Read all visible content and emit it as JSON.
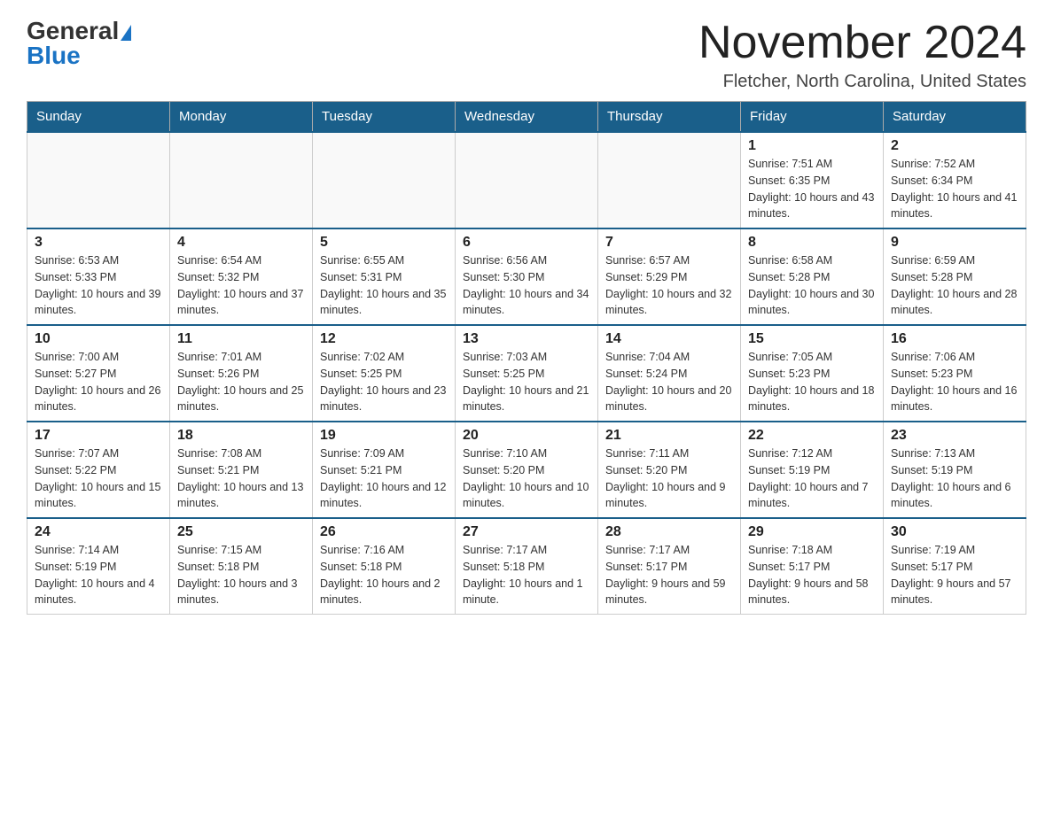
{
  "logo": {
    "general": "General",
    "triangle": "",
    "blue": "Blue"
  },
  "header": {
    "month": "November 2024",
    "location": "Fletcher, North Carolina, United States"
  },
  "days_of_week": [
    "Sunday",
    "Monday",
    "Tuesday",
    "Wednesday",
    "Thursday",
    "Friday",
    "Saturday"
  ],
  "weeks": [
    [
      {
        "day": "",
        "info": ""
      },
      {
        "day": "",
        "info": ""
      },
      {
        "day": "",
        "info": ""
      },
      {
        "day": "",
        "info": ""
      },
      {
        "day": "",
        "info": ""
      },
      {
        "day": "1",
        "info": "Sunrise: 7:51 AM\nSunset: 6:35 PM\nDaylight: 10 hours and 43 minutes."
      },
      {
        "day": "2",
        "info": "Sunrise: 7:52 AM\nSunset: 6:34 PM\nDaylight: 10 hours and 41 minutes."
      }
    ],
    [
      {
        "day": "3",
        "info": "Sunrise: 6:53 AM\nSunset: 5:33 PM\nDaylight: 10 hours and 39 minutes."
      },
      {
        "day": "4",
        "info": "Sunrise: 6:54 AM\nSunset: 5:32 PM\nDaylight: 10 hours and 37 minutes."
      },
      {
        "day": "5",
        "info": "Sunrise: 6:55 AM\nSunset: 5:31 PM\nDaylight: 10 hours and 35 minutes."
      },
      {
        "day": "6",
        "info": "Sunrise: 6:56 AM\nSunset: 5:30 PM\nDaylight: 10 hours and 34 minutes."
      },
      {
        "day": "7",
        "info": "Sunrise: 6:57 AM\nSunset: 5:29 PM\nDaylight: 10 hours and 32 minutes."
      },
      {
        "day": "8",
        "info": "Sunrise: 6:58 AM\nSunset: 5:28 PM\nDaylight: 10 hours and 30 minutes."
      },
      {
        "day": "9",
        "info": "Sunrise: 6:59 AM\nSunset: 5:28 PM\nDaylight: 10 hours and 28 minutes."
      }
    ],
    [
      {
        "day": "10",
        "info": "Sunrise: 7:00 AM\nSunset: 5:27 PM\nDaylight: 10 hours and 26 minutes."
      },
      {
        "day": "11",
        "info": "Sunrise: 7:01 AM\nSunset: 5:26 PM\nDaylight: 10 hours and 25 minutes."
      },
      {
        "day": "12",
        "info": "Sunrise: 7:02 AM\nSunset: 5:25 PM\nDaylight: 10 hours and 23 minutes."
      },
      {
        "day": "13",
        "info": "Sunrise: 7:03 AM\nSunset: 5:25 PM\nDaylight: 10 hours and 21 minutes."
      },
      {
        "day": "14",
        "info": "Sunrise: 7:04 AM\nSunset: 5:24 PM\nDaylight: 10 hours and 20 minutes."
      },
      {
        "day": "15",
        "info": "Sunrise: 7:05 AM\nSunset: 5:23 PM\nDaylight: 10 hours and 18 minutes."
      },
      {
        "day": "16",
        "info": "Sunrise: 7:06 AM\nSunset: 5:23 PM\nDaylight: 10 hours and 16 minutes."
      }
    ],
    [
      {
        "day": "17",
        "info": "Sunrise: 7:07 AM\nSunset: 5:22 PM\nDaylight: 10 hours and 15 minutes."
      },
      {
        "day": "18",
        "info": "Sunrise: 7:08 AM\nSunset: 5:21 PM\nDaylight: 10 hours and 13 minutes."
      },
      {
        "day": "19",
        "info": "Sunrise: 7:09 AM\nSunset: 5:21 PM\nDaylight: 10 hours and 12 minutes."
      },
      {
        "day": "20",
        "info": "Sunrise: 7:10 AM\nSunset: 5:20 PM\nDaylight: 10 hours and 10 minutes."
      },
      {
        "day": "21",
        "info": "Sunrise: 7:11 AM\nSunset: 5:20 PM\nDaylight: 10 hours and 9 minutes."
      },
      {
        "day": "22",
        "info": "Sunrise: 7:12 AM\nSunset: 5:19 PM\nDaylight: 10 hours and 7 minutes."
      },
      {
        "day": "23",
        "info": "Sunrise: 7:13 AM\nSunset: 5:19 PM\nDaylight: 10 hours and 6 minutes."
      }
    ],
    [
      {
        "day": "24",
        "info": "Sunrise: 7:14 AM\nSunset: 5:19 PM\nDaylight: 10 hours and 4 minutes."
      },
      {
        "day": "25",
        "info": "Sunrise: 7:15 AM\nSunset: 5:18 PM\nDaylight: 10 hours and 3 minutes."
      },
      {
        "day": "26",
        "info": "Sunrise: 7:16 AM\nSunset: 5:18 PM\nDaylight: 10 hours and 2 minutes."
      },
      {
        "day": "27",
        "info": "Sunrise: 7:17 AM\nSunset: 5:18 PM\nDaylight: 10 hours and 1 minute."
      },
      {
        "day": "28",
        "info": "Sunrise: 7:17 AM\nSunset: 5:17 PM\nDaylight: 9 hours and 59 minutes."
      },
      {
        "day": "29",
        "info": "Sunrise: 7:18 AM\nSunset: 5:17 PM\nDaylight: 9 hours and 58 minutes."
      },
      {
        "day": "30",
        "info": "Sunrise: 7:19 AM\nSunset: 5:17 PM\nDaylight: 9 hours and 57 minutes."
      }
    ]
  ]
}
